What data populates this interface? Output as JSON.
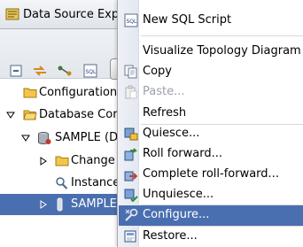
{
  "view": {
    "title": "Data Source Exp"
  },
  "tree": {
    "rows": [
      {
        "label": "Configuration"
      },
      {
        "label": "Database Cor"
      },
      {
        "label": "SAMPLE (DI"
      },
      {
        "label": "Change"
      },
      {
        "label": "Instance"
      },
      {
        "label": "SAMPLE"
      }
    ]
  },
  "menu": {
    "items": [
      {
        "label": "New SQL Script",
        "icon": "sql-script-icon"
      },
      {
        "label": "Visualize Topology Diagram",
        "icon": "none"
      },
      {
        "label": "Copy",
        "icon": "copy-icon"
      },
      {
        "label": "Paste...",
        "icon": "paste-icon",
        "disabled": true
      },
      {
        "label": "Refresh",
        "icon": "none"
      },
      {
        "label": "Quiesce...",
        "icon": "quiesce-icon"
      },
      {
        "label": "Roll forward...",
        "icon": "roll-forward-icon"
      },
      {
        "label": "Complete roll-forward...",
        "icon": "complete-roll-forward-icon"
      },
      {
        "label": "Unquiesce...",
        "icon": "unquiesce-icon"
      },
      {
        "label": "Configure...",
        "icon": "configure-icon",
        "highlighted": true
      },
      {
        "label": "Restore...",
        "icon": "restore-icon"
      }
    ]
  },
  "colors": {
    "selection": "#4a6fb0",
    "folder": "#e8b23a"
  }
}
